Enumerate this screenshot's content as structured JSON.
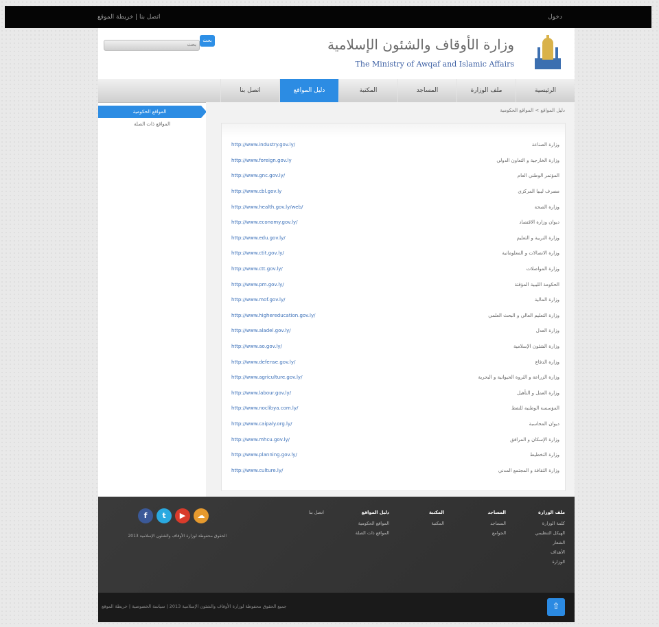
{
  "topbar": {
    "left_text": "اتصل بنا | خريطة الموقع",
    "right_text": "دخول"
  },
  "search": {
    "placeholder": "بحث",
    "button_label": "بحث"
  },
  "header": {
    "title_ar": "وزارة الأوقاف والشئون الإسلامية",
    "title_en": "The Ministry of Awqaf and Islamic Affairs"
  },
  "nav": {
    "items": [
      {
        "label": "الرئيسية"
      },
      {
        "label": "ملف الوزارة"
      },
      {
        "label": "المساجد"
      },
      {
        "label": "المكتبة"
      },
      {
        "label": "دليل المواقع"
      },
      {
        "label": "اتصل بنا"
      }
    ],
    "active_index": 4
  },
  "sidebar": {
    "items": [
      {
        "label": "المواقع الحكومية"
      },
      {
        "label": "المواقع ذات الصلة"
      }
    ]
  },
  "breadcrumb": "دليل المواقع > المواقع الحكومية",
  "links": [
    {
      "url": "http://www.industry.gov.ly/",
      "name": "وزارة الصناعة"
    },
    {
      "url": "http://www.foreign.gov.ly",
      "name": "وزارة الخارجية و التعاون الدولي"
    },
    {
      "url": "http://www.gnc.gov.ly/",
      "name": "المؤتمر الوطني العام"
    },
    {
      "url": "http://www.cbl.gov.ly",
      "name": "مصرف ليبيا المركزي"
    },
    {
      "url": "http://www.health.gov.ly/web/",
      "name": "وزارة الصحة"
    },
    {
      "url": "http://www.economy.gov.ly/",
      "name": "ديوان وزارة الاقتصاد"
    },
    {
      "url": "http://www.edu.gov.ly/",
      "name": "وزارة التربية و التعليم"
    },
    {
      "url": "http://www.ctit.gov.ly/",
      "name": "وزارة الاتصالات و المعلوماتية"
    },
    {
      "url": "http://www.ctt.gov.ly/",
      "name": "وزارة المواصلات"
    },
    {
      "url": "http://www.pm.gov.ly/",
      "name": "الحكومة الليبية المؤقتة"
    },
    {
      "url": "http://www.mof.gov.ly/",
      "name": "وزارة المالية"
    },
    {
      "url": "http://www.highereducation.gov.ly/",
      "name": "وزارة التعليم العالي و البحث العلمي"
    },
    {
      "url": "http://www.aladel.gov.ly/",
      "name": "وزارة العدل"
    },
    {
      "url": "http://www.ao.gov.ly/",
      "name": "وزارة الشئون الإسلامية"
    },
    {
      "url": "http://www.defense.gov.ly/",
      "name": "وزارة الدفاع"
    },
    {
      "url": "http://www.agriculture.gov.ly/",
      "name": "وزارة الزراعة و الثروة الحيوانية و البحرية"
    },
    {
      "url": "http://www.labour.gov.ly/",
      "name": "وزارة العمل و التأهيل"
    },
    {
      "url": "http://www.noclibya.com.ly/",
      "name": "المؤسسة الوطنية للنفط"
    },
    {
      "url": "http://www.caipaly.org.ly/",
      "name": "ديوان المحاسبة"
    },
    {
      "url": "http://www.mhcu.gov.ly/",
      "name": "وزارة الإسكان و المرافق"
    },
    {
      "url": "http://www.planning.gov.ly/",
      "name": "وزارة التخطيط"
    },
    {
      "url": "http://www.culture.ly/",
      "name": "وزارة الثقافة و المجتمع المدني"
    }
  ],
  "social": [
    {
      "icon": "facebook-icon",
      "glyph": "f",
      "color": "#3b5998"
    },
    {
      "icon": "twitter-icon",
      "glyph": "t",
      "color": "#2aa9e0"
    },
    {
      "icon": "youtube-icon",
      "glyph": "▶",
      "color": "#d93b2b"
    },
    {
      "icon": "soundcloud-icon",
      "glyph": "☁",
      "color": "#e69a2e"
    }
  ],
  "footer": {
    "about": "الحقوق محفوظة لوزارة الأوقاف والشئون الإسلامية 2013",
    "columns": [
      {
        "heading": "ملف الوزارة",
        "items": [
          "كلمة الوزارة",
          "الهيكل التنظيمي",
          "الشعار",
          "الأهداف",
          "الوزارة"
        ]
      },
      {
        "heading": "المساجد",
        "items": [
          "المساجد",
          "الجوامع"
        ]
      },
      {
        "heading": "المكتبة",
        "items": [
          "المكتبة"
        ]
      },
      {
        "heading": "دليل المواقع",
        "items": [
          "المواقع الحكومية",
          "المواقع ذات الصلة"
        ]
      },
      {
        "heading": "",
        "items": [
          "اتصل بنا"
        ]
      }
    ]
  },
  "bottombar": {
    "copyright": "جميع الحقوق محفوظة لوزارة الأوقاف والشئون الإسلامية 2013 | سياسة الخصوصية | خريطة الموقع",
    "to_top_glyph": "⇧"
  }
}
